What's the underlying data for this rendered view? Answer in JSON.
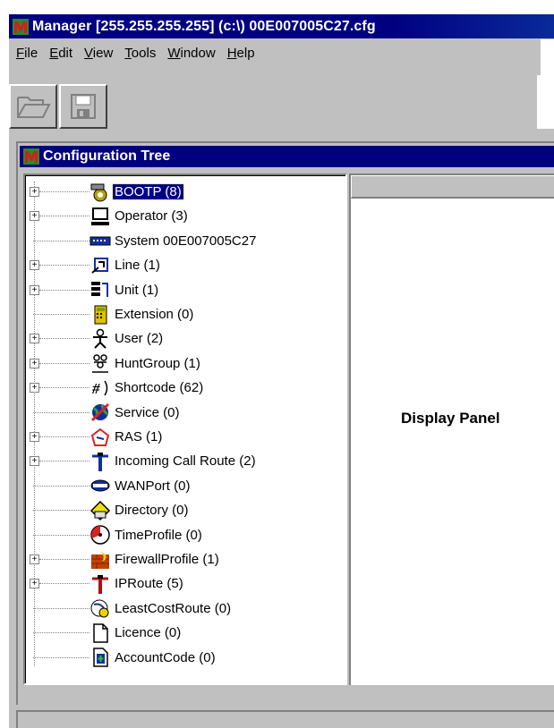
{
  "window": {
    "title": "Manager [255.255.255.255] (c:\\) 00E007005C27.cfg"
  },
  "menu": [
    {
      "label": "File",
      "key": "F"
    },
    {
      "label": "Edit",
      "key": "E"
    },
    {
      "label": "View",
      "key": "V"
    },
    {
      "label": "Tools",
      "key": "T"
    },
    {
      "label": "Window",
      "key": "W"
    },
    {
      "label": "Help",
      "key": "H"
    }
  ],
  "toolbar": {
    "buttons": [
      {
        "icon": "open-folder-icon"
      },
      {
        "icon": "save-disk-icon"
      }
    ]
  },
  "config_tree": {
    "title": "Configuration Tree",
    "items": [
      {
        "label": "BOOTP (8)",
        "icon": "bootp-icon",
        "expandable": true,
        "selected": true
      },
      {
        "label": "Operator (3)",
        "icon": "operator-icon",
        "expandable": true
      },
      {
        "label": "System 00E007005C27",
        "icon": "system-icon",
        "expandable": false
      },
      {
        "label": "Line (1)",
        "icon": "line-icon",
        "expandable": true
      },
      {
        "label": "Unit (1)",
        "icon": "unit-icon",
        "expandable": true
      },
      {
        "label": "Extension (0)",
        "icon": "extension-icon",
        "expandable": false
      },
      {
        "label": "User (2)",
        "icon": "user-icon",
        "expandable": true
      },
      {
        "label": "HuntGroup (1)",
        "icon": "huntgroup-icon",
        "expandable": true
      },
      {
        "label": "Shortcode (62)",
        "icon": "shortcode-icon",
        "expandable": true
      },
      {
        "label": "Service (0)",
        "icon": "service-icon",
        "expandable": false
      },
      {
        "label": "RAS (1)",
        "icon": "ras-icon",
        "expandable": true
      },
      {
        "label": "Incoming Call Route (2)",
        "icon": "incoming-call-route-icon",
        "expandable": true
      },
      {
        "label": "WANPort (0)",
        "icon": "wanport-icon",
        "expandable": false
      },
      {
        "label": "Directory (0)",
        "icon": "directory-icon",
        "expandable": false
      },
      {
        "label": "TimeProfile (0)",
        "icon": "timeprofile-icon",
        "expandable": false
      },
      {
        "label": "FirewallProfile (1)",
        "icon": "firewall-icon",
        "expandable": true
      },
      {
        "label": "IPRoute (5)",
        "icon": "iproute-icon",
        "expandable": true
      },
      {
        "label": "LeastCostRoute (0)",
        "icon": "leastcostroute-icon",
        "expandable": false
      },
      {
        "label": "Licence (0)",
        "icon": "licence-icon",
        "expandable": false
      },
      {
        "label": "AccountCode (0)",
        "icon": "accountcode-icon",
        "expandable": false
      }
    ]
  },
  "display_panel": {
    "label": "Display Panel"
  },
  "colors": {
    "titlebar": "#000080",
    "chrome": "#c0c0c0",
    "selection": "#000080"
  }
}
